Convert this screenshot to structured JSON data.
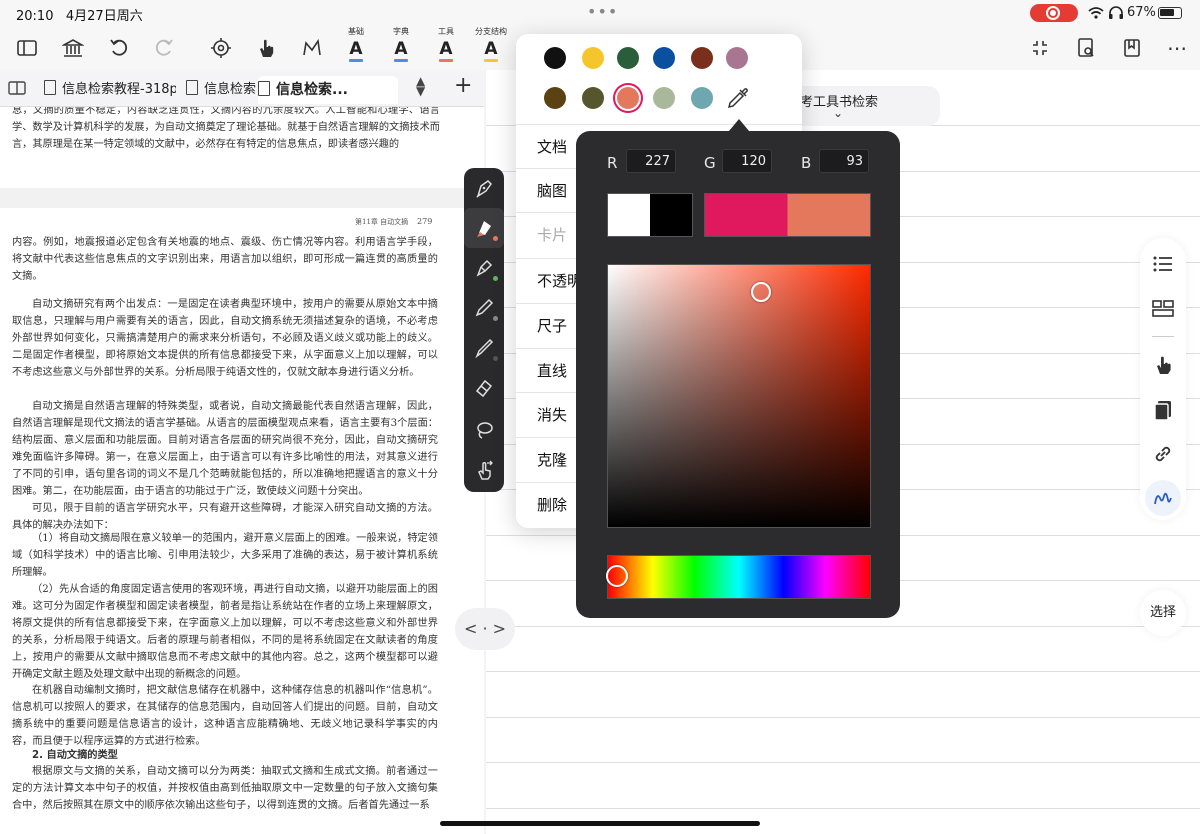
{
  "status_bar": {
    "time": "20:10",
    "date": "4月27日周六",
    "battery": "67%"
  },
  "toolbar": {
    "icons": [
      "sidebar-icon",
      "library-icon",
      "undo-icon",
      "redo-icon",
      "settings-icon",
      "hand-icon",
      "highlight-icon"
    ],
    "format_buttons": [
      {
        "label": "基础",
        "glyph": "A",
        "color": "#4a90e2"
      },
      {
        "label": "字典",
        "glyph": "A",
        "color": "#4a90e2"
      },
      {
        "label": "工具",
        "glyph": "A",
        "color": "#e2785d"
      },
      {
        "label": "分支结构",
        "glyph": "A",
        "color": "#f5c542"
      }
    ],
    "right_icons": [
      "collapse-icon",
      "search-document-icon",
      "bookmark-icon",
      "more-icon"
    ]
  },
  "tabs": [
    {
      "label": "信息检索教程-318p"
    },
    {
      "label": "信息检索"
    },
    {
      "label": "信息检索..."
    }
  ],
  "document": {
    "top_text": "息，文摘的质量不稳定，内容缺乏连贯性，文摘内容的冗余度较大。人工智能和心理学、语言学、数学及计算机科学的发展，为自动文摘奠定了理论基础。就基于自然语言理解的文摘技术而言，其原理是在某一特定领域的文献中，必然存在有特定的信息焦点，即读者感兴趣的",
    "page_header": "第11章  自动文摘",
    "page_number": "279",
    "paragraphs": [
      "内容。例如，地震报道必定包含有关地震的地点、震级、伤亡情况等内容。利用语言学手段，将文献中代表这些信息焦点的文字识别出来，用语言加以组织，即可形成一篇连贯的高质量的文摘。",
      "自动文摘研究有两个出发点：一是固定在读者典型环境中，按用户的需要从原始文本中摘取信息，只理解与用户需要有关的语言，因此，自动文摘系统无须描述复杂的语境，不必考虑外部世界如何变化，只需搞清楚用户的需求来分析语句，不必顾及语义歧义或功能上的歧义。二是固定作者模型，即将原始文本提供的所有信息都接受下来，从字面意义上加以理解，可以不考虑这些意义与外部世界的关系。分析局限于纯语文性的，仅就文献本身进行语义分析。",
      "自动文摘是自然语言理解的特殊类型，或者说，自动文摘最能代表自然语言理解，因此，自然语言理解是现代文摘法的语言学基础。从语言的层面模型观点来看，语言主要有3个层面：结构层面、意义层面和功能层面。目前对语言各层面的研究尚很不充分，因此，自动文摘研究难免面临许多障碍。第一，在意义层面上，由于语言可以有许多比喻性的用法，对其意义进行了不同的引申，语句里各词的词义不是几个范畴就能包括的，所以准确地把握语言的意义十分困难。第二，在功能层面，由于语言的功能过于广泛，致使歧义问题十分突出。",
      "可见，限于目前的语言学研究水平，只有避开这些障碍，才能深入研究自动文摘的方法。具体的解决办法如下：",
      "（1）将自动文摘局限在意义较单一的范围内，避开意义层面上的困难。一般来说，特定领域（如科学技术）中的语言比喻、引申用法较少，大多采用了准确的表达，易于被计算机系统所理解。",
      "（2）先从合适的角度固定语言使用的客观环境，再进行自动文摘，以避开功能层面上的困难。这可分为固定作者模型和固定读者模型，前者是指让系统站在作者的立场上来理解原文，将原文提供的所有信息都接受下来，在字面意义上加以理解，可以不考虑这些意义和外部世界的关系，分析局限于纯语文。后者的原理与前者相似，不同的是将系统固定在文献读者的角度上，按用户的需要从文献中摘取信息而不考虑文献中的其他内容。总之，这两个模型都可以避开确定文献主题及处理文献中出现的新概念的问题。",
      "在机器自动编制文摘时，把文献信息储存在机器中，这种储存信息的机器叫作“信息机”。信息机可以按照人的要求，在其储存的信息范围内，自动回答人们提出的问题。目前，自动文摘系统中的重要问题是信息语言的设计，这种语言应能精确地、无歧义地记录科学事实的内容，而且便于以程序运算的方式进行检索。",
      "2. 自动文摘的类型",
      "根据原文与文摘的关系，自动文摘可以分为两类：抽取式文摘和生成式文摘。前者通过一定的方法计算文本中句子的权值，并按权值由高到低抽取原文中一定数量的句子放入文摘句集合中，然后按照其在原文中的顺序依次输出这些句子，以得到连贯的文摘。后者首先通过一系"
    ]
  },
  "pen_tools": [
    {
      "name": "fountain-pen-icon",
      "dot": null
    },
    {
      "name": "highlighter-icon",
      "dot": "#e3785d"
    },
    {
      "name": "marker-icon",
      "dot": "#5cb85c"
    },
    {
      "name": "pencil-icon",
      "dot": "#888888"
    },
    {
      "name": "brush-icon",
      "dot": "#555555"
    },
    {
      "name": "eraser-icon",
      "dot": null
    },
    {
      "name": "lasso-icon",
      "dot": null
    },
    {
      "name": "touch-icon",
      "dot": null
    }
  ],
  "notebook": {
    "ref_tab": "参考工具书检索",
    "sidebar_icons": [
      "list-icon",
      "layout-icon",
      "hand-pointer-icon",
      "copy-icon",
      "link-icon",
      "squiggle-icon"
    ],
    "select_label": "选择",
    "pager": "< · >"
  },
  "context_menu": {
    "swatches_row1": [
      "#111111",
      "#f5c62c",
      "#2a5e3a",
      "#0a4fa0",
      "#7a2e1c",
      "#a87690"
    ],
    "swatches_row2": [
      "#5a4212",
      "#55562e",
      "#e3785d",
      "#a9b79b",
      "#6fa7b0"
    ],
    "items": [
      {
        "label": "文档",
        "enabled": true
      },
      {
        "label": "脑图",
        "enabled": true
      },
      {
        "label": "卡片",
        "enabled": false
      },
      {
        "label": "不透明",
        "enabled": true
      },
      {
        "label": "尺子",
        "enabled": true
      },
      {
        "label": "直线",
        "enabled": true
      },
      {
        "label": "消失",
        "enabled": true
      },
      {
        "label": "克隆",
        "enabled": true
      },
      {
        "label": "删除",
        "enabled": true
      }
    ]
  },
  "color_picker": {
    "r_label": "R",
    "r": "227",
    "g_label": "G",
    "g": "120",
    "b_label": "B",
    "b": "93",
    "preview_colors": [
      "#ffffff",
      "#000000",
      "#e0185d",
      "#e3785d"
    ],
    "current_color": "#e3785d",
    "hue_base": "#ff2a00"
  }
}
